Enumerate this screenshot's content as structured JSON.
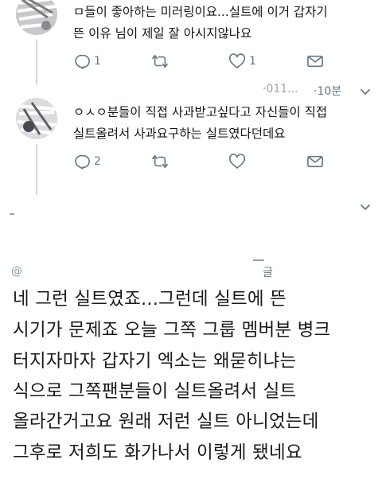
{
  "tweets": [
    {
      "text_lines": [
        "ㅁ들이 좋아하는 미러링이요...실트에 이거 갑자기",
        "뜬 이유 님이 제일 잘 아시지않나요"
      ],
      "reply_count": "1",
      "retweet_count": "",
      "like_count": "1"
    },
    {
      "handle_partial": "·011...",
      "time": "·10분",
      "text_lines": [
        "ㅇㅅㅇ분들이 직접 사과받고싶다고 자신들이 직접",
        "실트올려서 사과요구하는 실트였다던데요"
      ],
      "reply_count": "2",
      "retweet_count": "",
      "like_count": ""
    }
  ],
  "third_header": {
    "handle_partial": "@",
    "label_partial": "글"
  },
  "main_text_lines": [
    "네 그런 실트였죠...그런데 실트에 뜬",
    "시기가 문제죠 오늘 그쪽 그룹 멤버분 병크",
    "터지자마자 갑자기 엑소는 왜묻히냐는",
    "식으로 그쪽팬분들이 실트올려서 실트",
    "올라간거고요 원래 저런 실트 아니었는데",
    "그후로 저희도 화가나서 이렇게 됐네요"
  ],
  "icons": {
    "reply": "reply-icon",
    "retweet": "retweet-icon",
    "like": "heart-icon",
    "message": "envelope-icon",
    "caret": "chevron-down-icon"
  },
  "colors": {
    "icon_gray": "#657786",
    "thread_line": "#ccd6dd",
    "text": "#14171a"
  }
}
